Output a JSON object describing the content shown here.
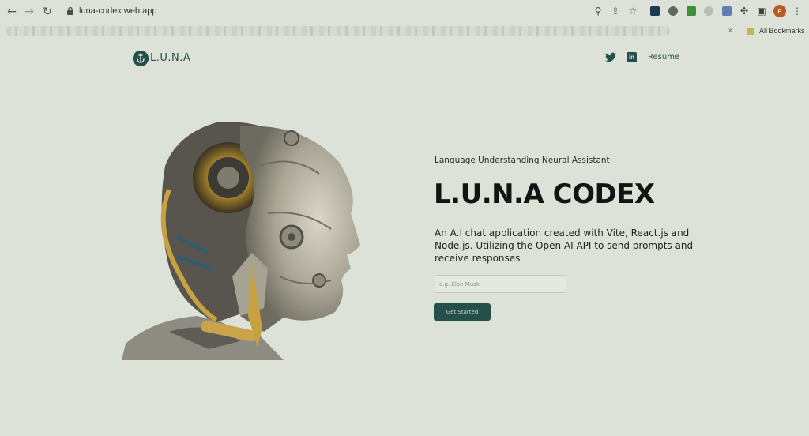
{
  "browser": {
    "url": "luna-codex.web.app",
    "profile_initial": "e",
    "bookmarks_more": "»",
    "bookmarks_all": "All Bookmarks",
    "icons": [
      "back-arrow-icon",
      "forward-arrow-icon",
      "reload-icon",
      "lock-icon",
      "zoom-icon",
      "share-icon",
      "star-icon",
      "extensions-puzzle-icon",
      "side-panel-icon",
      "kebab-menu-icon"
    ]
  },
  "nav": {
    "logo_text": "L.U.N.A",
    "resume_label": "Resume",
    "social": [
      "twitter-icon",
      "linkedin-icon"
    ]
  },
  "hero": {
    "tagline": "Language Understanding Neural Assistant",
    "title": "L.U.N.A CODEX",
    "description": "An A.I chat application created with Vite, React.js and Node.js. Utilizing the Open AI API to send prompts and receive responses",
    "input_placeholder": "e.g. Elon Musk",
    "cta_label": "Get Started"
  },
  "colors": {
    "background": "#dde2d9",
    "accent": "#25504a",
    "text": "#111511"
  }
}
